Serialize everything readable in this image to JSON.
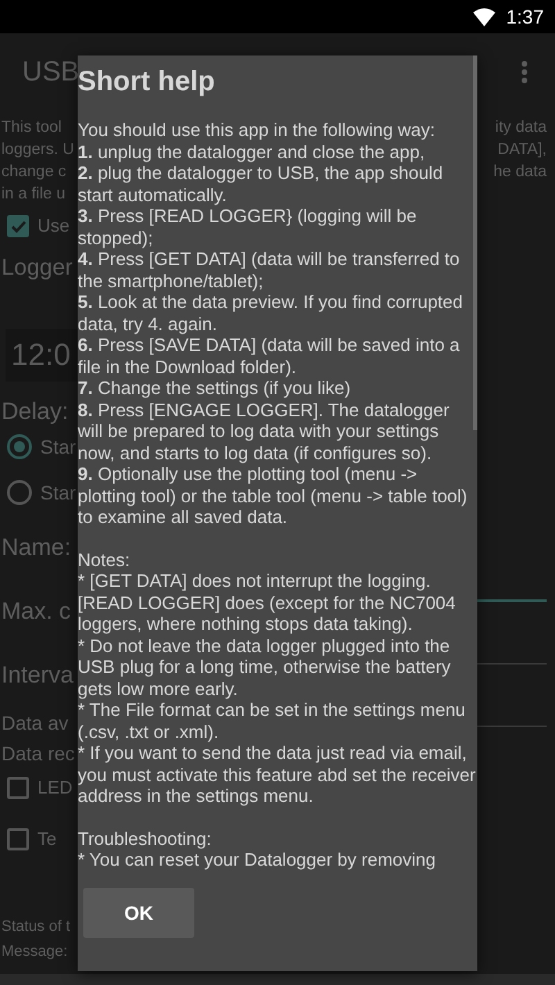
{
  "status_bar": {
    "time": "1:37"
  },
  "app": {
    "title": "USB",
    "intro_left": [
      "This tool",
      "loggers. U",
      "change c",
      "in a file u"
    ],
    "intro_right": [
      "ity data",
      "DATA],",
      "he data"
    ],
    "use_checkbox": {
      "label": "Use",
      "checked": true
    },
    "logger_heading": "Logger",
    "time_value": "12:0",
    "delay_label": "Delay:",
    "delay_options": [
      {
        "label": "Star",
        "selected": true
      },
      {
        "label": "Star",
        "selected": false
      }
    ],
    "name_label": "Name:",
    "max_label": "Max. c",
    "interval_label": "Interva",
    "data_lines": [
      "Data av",
      "Data rec"
    ],
    "options": [
      {
        "label": "LED",
        "checked": false
      },
      {
        "label": "Te",
        "checked": false
      }
    ],
    "status_lines": [
      "Status of t",
      "Message:"
    ]
  },
  "dialog": {
    "title": "Short help",
    "intro": "You should use this app in the following way:",
    "steps": [
      "**1.** unplug the datalogger and close the app,",
      "**2.** plug the datalogger to USB, the app should start automatically.",
      "**3.** Press [READ LOGGER} (logging will be stopped);",
      "**4.** Press [GET DATA] (data will be transferred to the smartphone/tablet);",
      "**5.** Look at the data preview. If you find corrupted data, try 4. again.",
      "**6.** Press [SAVE DATA] (data will be saved into a file in the Download folder).",
      "**7.** Change the settings (if you like)",
      "**8.** Press [ENGAGE LOGGER]. The datalogger will be prepared to log data with your settings now, and starts to log data (if configures so).",
      "**9.** Optionally use the plotting tool (menu -> plotting tool) or the table tool (menu -> table tool) to examine all saved data."
    ],
    "notes_heading": "Notes:",
    "notes": [
      "* [GET DATA] does not interrupt the logging. [READ LOGGER] does (except for the NC7004 loggers, where nothing stops data taking).",
      "* Do not leave the data logger plugged into the USB plug for a long time, otherwise the battery gets low more early.",
      "* The File format can be set in the settings menu (.csv, .txt or .xml).",
      "* If you want to send the data just read via email, you must activate this feature abd set the receiver address in the settings menu."
    ],
    "troubleshooting_heading": "Troubleshooting:",
    "troubleshooting": [
      "* You can reset your Datalogger by removing"
    ],
    "button": "OK"
  }
}
